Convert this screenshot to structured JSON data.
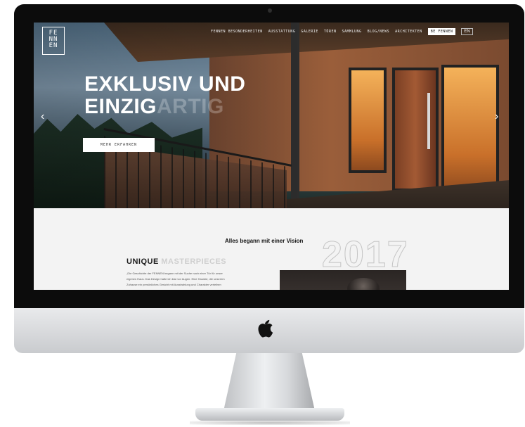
{
  "logo": {
    "lines": [
      "FE",
      "NN",
      "EN"
    ]
  },
  "nav": {
    "items": [
      "FENNEN BESONDERHEITEN",
      "AUSSTATTUNG",
      "GALERIE",
      "TÜREN",
      "SAMMLUNG",
      "BLOG/NEWS",
      "ARCHITEKTEN"
    ],
    "cta": "BE FENNEN",
    "lang": "EN"
  },
  "hero": {
    "title_line1": "EXKLUSIV UND",
    "title_line2_bold": "EINZIG",
    "title_line2_faint": "ARTIG",
    "button": "MEHR ERFAHREN",
    "arrow_left": "‹",
    "arrow_right": "›"
  },
  "section": {
    "heading": "Alles begann mit einer Vision",
    "year": "2017",
    "subheading_bold": "UNIQUE",
    "subheading_faint": "MASTERPIECES",
    "body_lines": [
      "„Die Geschichte der FENNEN begann mit der Suche nach einer Tür für unser",
      "eigenes Haus. Das Design hatte ich klar vor Augen. Eine Haustür, die unserem",
      "Zuhause ein persönliches Gesicht mit Ausstrahlung und Charakter verleihen"
    ]
  }
}
